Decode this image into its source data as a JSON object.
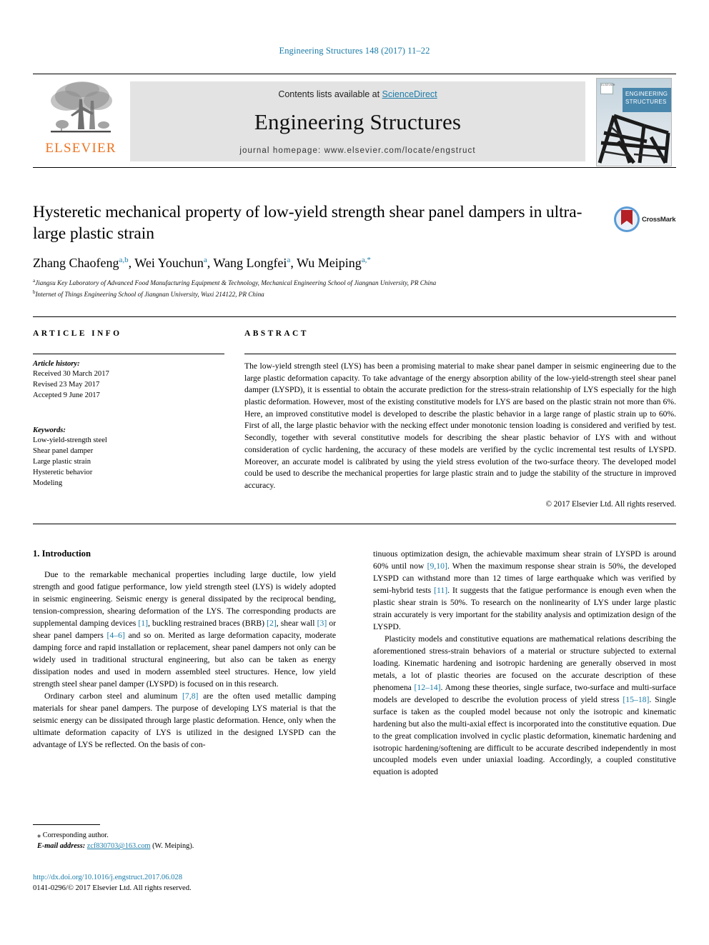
{
  "running_head": "Engineering Structures 148 (2017) 11–22",
  "masthead": {
    "contents_prefix": "Contents lists available at ",
    "sciencedirect": "ScienceDirect",
    "journal_name": "Engineering Structures",
    "homepage": "journal homepage: www.elsevier.com/locate/engstruct",
    "publisher_logo_text": "ELSEVIER",
    "cover_title_line1": "ENGINEERING",
    "cover_title_line2": "STRUCTURES",
    "cover_mark_text": "ELSEVIER"
  },
  "article": {
    "title": "Hysteretic mechanical property of low-yield strength shear panel dampers in ultra-large plastic strain",
    "authors_html": "Zhang Chaofeng<sup>a,b</sup>, Wei Youchun<sup>a</sup>, Wang Longfei<sup>a</sup>, Wu Meiping<sup>a,*</sup>",
    "affiliation_a": "Jiangsu Key Laboratory of Advanced Food Manufacturing Equipment & Technology, Mechanical Engineering School of Jiangnan University, PR China",
    "affiliation_b": "Internet of Things Engineering School of Jiangnan University, Wuxi 214122, PR China",
    "crossmark_label": "CrossMark"
  },
  "info": {
    "heading": "ARTICLE INFO",
    "history_title": "Article history:",
    "history": [
      "Received 30 March 2017",
      "Revised 23 May 2017",
      "Accepted 9 June 2017"
    ],
    "keywords_title": "Keywords:",
    "keywords": [
      "Low-yield-strength steel",
      "Shear panel damper",
      "Large plastic strain",
      "Hysteretic behavior",
      "Modeling"
    ]
  },
  "abstract": {
    "heading": "ABSTRACT",
    "text": "The low-yield strength steel (LYS) has been a promising material to make shear panel damper in seismic engineering due to the large plastic deformation capacity. To take advantage of the energy absorption ability of the low-yield-strength steel shear panel damper (LYSPD), it is essential to obtain the accurate prediction for the stress-strain relationship of LYS especially for the high plastic deformation. However, most of the existing constitutive models for LYS are based on the plastic strain not more than 6%. Here, an improved constitutive model is developed to describe the plastic behavior in a large range of plastic strain up to 60%. First of all, the large plastic behavior with the necking effect under monotonic tension loading is considered and verified by test. Secondly, together with several constitutive models for describing the shear plastic behavior of LYS with and without consideration of cyclic hardening, the accuracy of these models are verified by the cyclic incremental test results of LYSPD. Moreover, an accurate model is calibrated by using the yield stress evolution of the two-surface theory. The developed model could be used to describe the mechanical properties for large plastic strain and to judge the stability of the structure in improved accuracy.",
    "copyright": "© 2017 Elsevier Ltd. All rights reserved."
  },
  "body": {
    "section_heading": "1. Introduction",
    "left_paragraphs": [
      "Due to the remarkable mechanical properties including large ductile, low yield strength and good fatigue performance, low yield strength steel (LYS) is widely adopted in seismic engineering. Seismic energy is general dissipated by the reciprocal bending, tension-compression, shearing deformation of the LYS. The corresponding products are supplemental damping devices [1], buckling restrained braces (BRB) [2], shear wall [3] or shear panel dampers [4–6] and so on. Merited as large deformation capacity, moderate damping force and rapid installation or replacement, shear panel dampers not only can be widely used in traditional structural engineering, but also can be taken as energy dissipation nodes and used in modern assembled steel structures. Hence, low yield strength steel shear panel damper (LYSPD) is focused on in this research.",
      "Ordinary carbon steel and aluminum [7,8] are the often used metallic damping materials for shear panel dampers. The purpose of developing LYS material is that the seismic energy can be dissipated through large plastic deformation. Hence, only when the ultimate deformation capacity of LYS is utilized in the designed LYSPD can the advantage of LYS be reflected. On the basis of con-"
    ],
    "right_paragraphs": [
      "tinuous optimization design, the achievable maximum shear strain of LYSPD is around 60% until now [9,10]. When the maximum response shear strain is 50%, the developed LYSPD can withstand more than 12 times of large earthquake which was verified by semi-hybrid tests [11]. It suggests that the fatigue performance is enough even when the plastic shear strain is 50%. To research on the nonlinearity of LYS under large plastic strain accurately is very important for the stability analysis and optimization design of the LYSPD.",
      "Plasticity models and constitutive equations are mathematical relations describing the aforementioned stress-strain behaviors of a material or structure subjected to external loading. Kinematic hardening and isotropic hardening are generally observed in most metals, a lot of plastic theories are focused on the accurate description of these phenomena [12–14]. Among these theories, single surface, two-surface and multi-surface models are developed to describe the evolution process of yield stress [15–18]. Single surface is taken as the coupled model because not only the isotropic and kinematic hardening but also the multi-axial effect is incorporated into the constitutive equation. Due to the great complication involved in cyclic plastic deformation, kinematic hardening and isotropic hardening/softening are difficult to be accurate described independently in most uncoupled models even under uniaxial loading. Accordingly, a coupled constitutive equation is adopted"
    ]
  },
  "footnote": {
    "corresponding": "⁎ Corresponding author.",
    "email_label": "E-mail address:",
    "email": "zcf830703@163.com",
    "email_suffix": "(W. Meiping)."
  },
  "footer": {
    "doi": "http://dx.doi.org/10.1016/j.engstruct.2017.06.028",
    "issn": "0141-0296/© 2017 Elsevier Ltd. All rights reserved."
  },
  "colors": {
    "link_blue": "#1a7ba8",
    "elsevier_orange": "#ee7422",
    "band_grey": "#e3e3e3",
    "cover_blue": "#4a87ad",
    "crossmark_red": "#b42025"
  }
}
